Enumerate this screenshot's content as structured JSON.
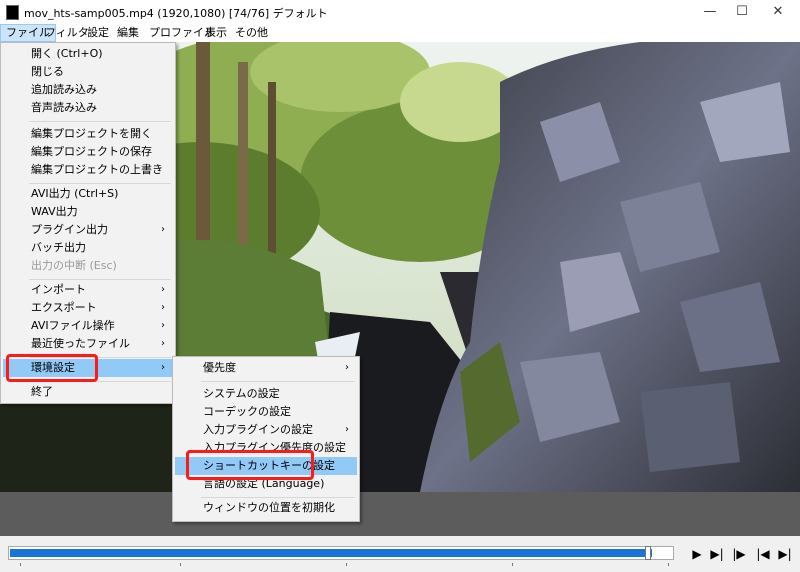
{
  "window": {
    "title": "mov_hts-samp005.mp4 (1920,1080)  [74/76]  デフォルト",
    "controls": [
      "—",
      "☐",
      "✕"
    ]
  },
  "menubar": [
    "ファイル",
    "フィルタ",
    "設定",
    "編集",
    "プロファイル",
    "表示",
    "その他"
  ],
  "file_menu": {
    "items": [
      {
        "label": "開く (Ctrl+O)"
      },
      {
        "label": "閉じる"
      },
      {
        "label": "追加読み込み"
      },
      {
        "label": "音声読み込み"
      },
      {
        "label": "編集プロジェクトを開く"
      },
      {
        "label": "編集プロジェクトの保存"
      },
      {
        "label": "編集プロジェクトの上書き"
      },
      {
        "label": "AVI出力 (Ctrl+S)"
      },
      {
        "label": "WAV出力"
      },
      {
        "label": "プラグイン出力"
      },
      {
        "label": "バッチ出力"
      },
      {
        "label": "出力の中断 (Esc)"
      },
      {
        "label": "インポート"
      },
      {
        "label": "エクスポート"
      },
      {
        "label": "AVIファイル操作"
      },
      {
        "label": "最近使ったファイル"
      },
      {
        "label": "環境設定"
      },
      {
        "label": "終了"
      }
    ]
  },
  "settings_submenu": {
    "items": [
      {
        "label": "優先度"
      },
      {
        "label": "システムの設定"
      },
      {
        "label": "コーデックの設定"
      },
      {
        "label": "入力プラグインの設定"
      },
      {
        "label": "入力プラグイン優先度の設定"
      },
      {
        "label": "ショートカットキーの設定"
      },
      {
        "label": "言語の設定 (Language)"
      },
      {
        "label": "ウィンドウの位置を初期化"
      }
    ]
  },
  "playback": {
    "position_fraction": 0.973,
    "controls": [
      "▶",
      "▶|",
      "|▶",
      "|◀",
      "▶|"
    ]
  },
  "colors": {
    "seek_fill": "#1a73d9",
    "highlight": "#91c9f7",
    "annotation": "#ff1a1a"
  }
}
